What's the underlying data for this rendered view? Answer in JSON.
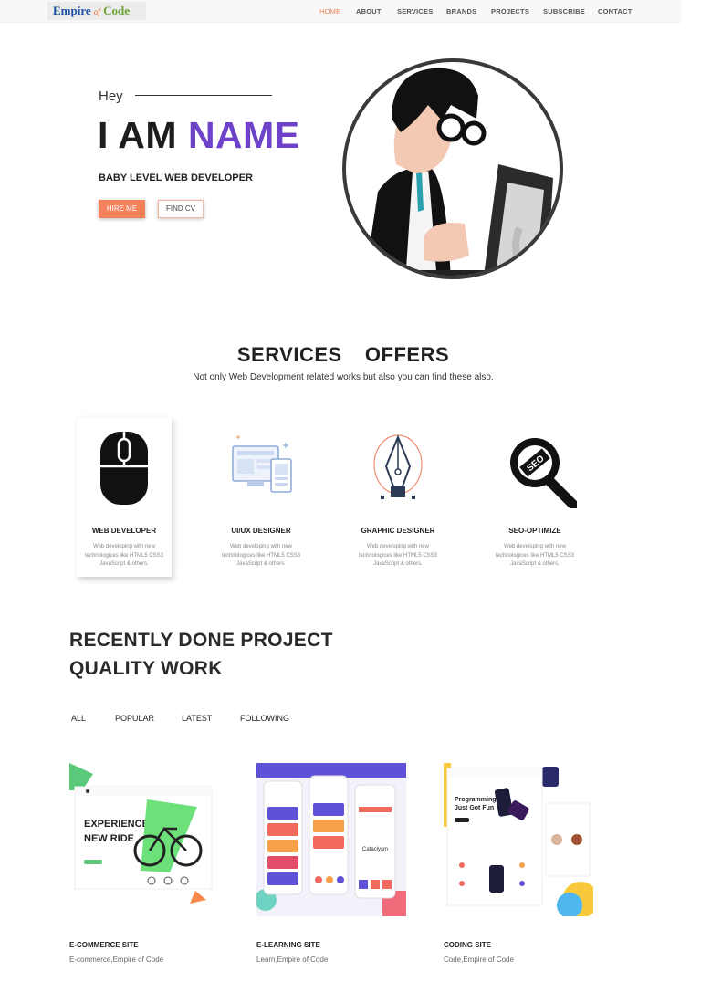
{
  "nav": {
    "logo": {
      "part1": "Empire",
      "part2": "of",
      "part3": "Code"
    },
    "items": [
      "HOME",
      "ABOUT",
      "SERVICES",
      "BRANDS",
      "PROJECTS",
      "SUBSCRIBE",
      "CONTACT"
    ],
    "active": "HOME"
  },
  "hero": {
    "greeting": "Hey",
    "title_prefix": "I AM",
    "title_name": "NAME",
    "role": "BABY LEVEL WEB DEVELOPER",
    "hire_button": "HIRE ME",
    "cv_button": "FIND CV"
  },
  "services": {
    "title": "SERVICES  OFFERS",
    "subtitle": "Not only Web Development related works but also you can find these also.",
    "cards": [
      {
        "title": "WEB DEVELOPER",
        "desc": "Web developing with new technologices like HTML5 CSS3 JavaScript & others.",
        "icon": "mouse-icon"
      },
      {
        "title": "UI/UX DESIGNER",
        "desc": "Web developing with new technologices like HTML5 CSS3 JavaScript & others.",
        "icon": "devices-icon"
      },
      {
        "title": "GRAPHIC DESIGNER",
        "desc": "Web developing with new technologices like HTML5 CSS3 JavaScript & others.",
        "icon": "pen-tool-icon"
      },
      {
        "title": "SEO-OPTIMIZE",
        "desc": "Web developing with new technologices like HTML5 CSS3 JavaScript & others.",
        "icon": "seo-magnifier-icon",
        "icon_text": "SEO"
      }
    ]
  },
  "projects": {
    "heading_line1": "RECENTLY DONE PROJECT",
    "heading_line2": "QUALITY WORK",
    "filters": [
      "ALL",
      "POPULAR",
      "LATEST",
      "FOLLOWING"
    ],
    "items": [
      {
        "title": "E-COMMERCE SITE",
        "subtitle": "E-commerce,Empire of Code",
        "thumb_line1": "EXPERIENCE",
        "thumb_line2": "NEW RIDE"
      },
      {
        "title": "E-LEARNING SITE",
        "subtitle": "Learn,Empire of Code",
        "thumb_text": "Cataclysm"
      },
      {
        "title": "CODING SITE",
        "subtitle": "Code,Empire of Code",
        "thumb_line1": "Programming",
        "thumb_line2": "Just Got Fun"
      }
    ]
  },
  "colors": {
    "accent": "#f5805b",
    "name_purple": "#6e43c9",
    "nav_active": "#f37f52"
  }
}
